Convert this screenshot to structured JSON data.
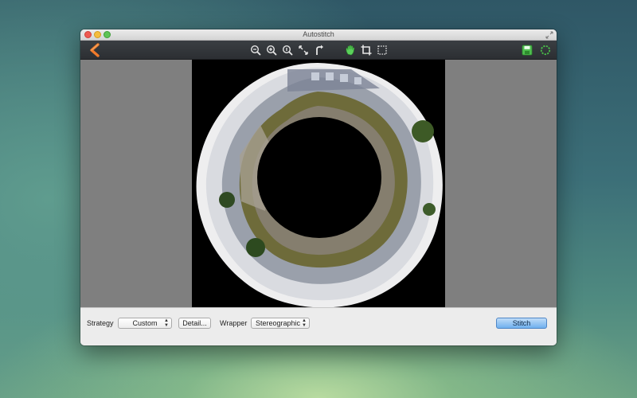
{
  "window": {
    "title": "Autostitch"
  },
  "toolbar": {
    "left_icons": [
      "back-arrow-icon"
    ],
    "center_icons": [
      "zoom-out-icon",
      "zoom-in-icon",
      "zoom-actual-icon",
      "fit-screen-icon",
      "rotate-icon",
      "hand-tool-icon",
      "crop-icon",
      "selection-icon"
    ],
    "right_icons": [
      "save-icon",
      "progress-ring-icon"
    ]
  },
  "bottom": {
    "strategy_label": "Strategy",
    "strategy_value": "Custom",
    "detail_button": "Detail...",
    "wrapper_label": "Wrapper",
    "wrapper_value": "Stereographic",
    "stitch_button": "Stitch"
  },
  "colors": {
    "accent_back": "#f07a2a",
    "hand_green": "#5bd15b",
    "save_green": "#4fbf4f",
    "primary_button": "#6fb0ee"
  }
}
